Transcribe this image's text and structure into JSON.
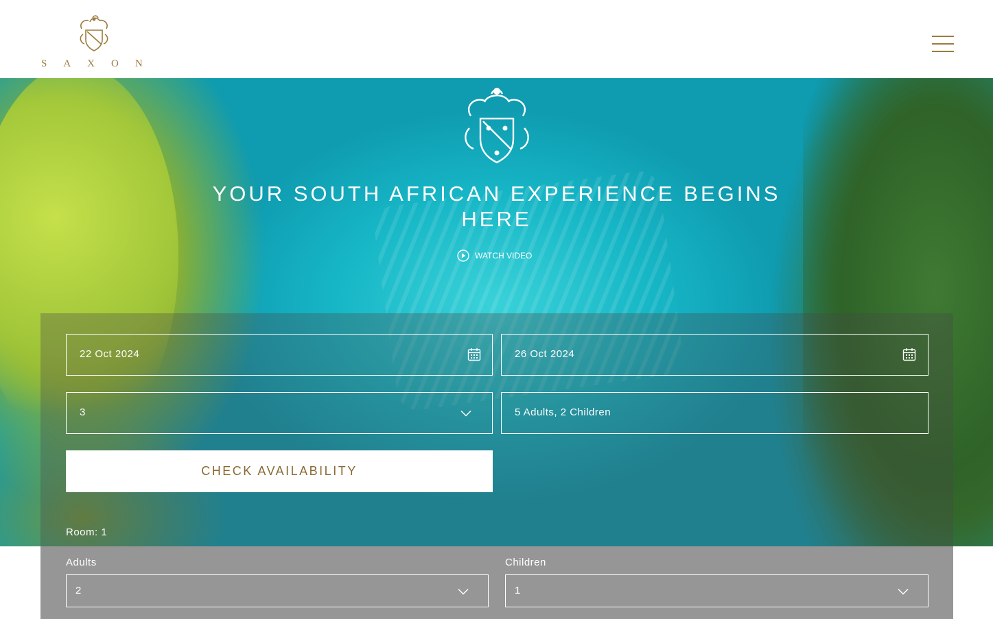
{
  "header": {
    "logo_text": "SAXON",
    "menu_icon": "hamburger-menu-icon",
    "brand_color": "#9b7b3e"
  },
  "hero": {
    "title": "YOUR SOUTH AFRICAN EXPERIENCE BEGINS HERE",
    "watch_video_label": "WATCH VIDEO",
    "crest_icon": "crest-icon",
    "play_icon": "play-circle-icon"
  },
  "booking": {
    "check_in": "22 Oct 2024",
    "check_out": "26 Oct 2024",
    "rooms": "3",
    "guests": "5 Adults, 2 Children",
    "check_button_label": "CHECK AVAILABILITY",
    "calendar_icon": "calendar-icon",
    "chevron_icon": "chevron-down-icon"
  },
  "room_config": {
    "room_label": "Room: 1",
    "adults_label": "Adults",
    "adults_value": "2",
    "children_label": "Children",
    "children_value": "1"
  }
}
